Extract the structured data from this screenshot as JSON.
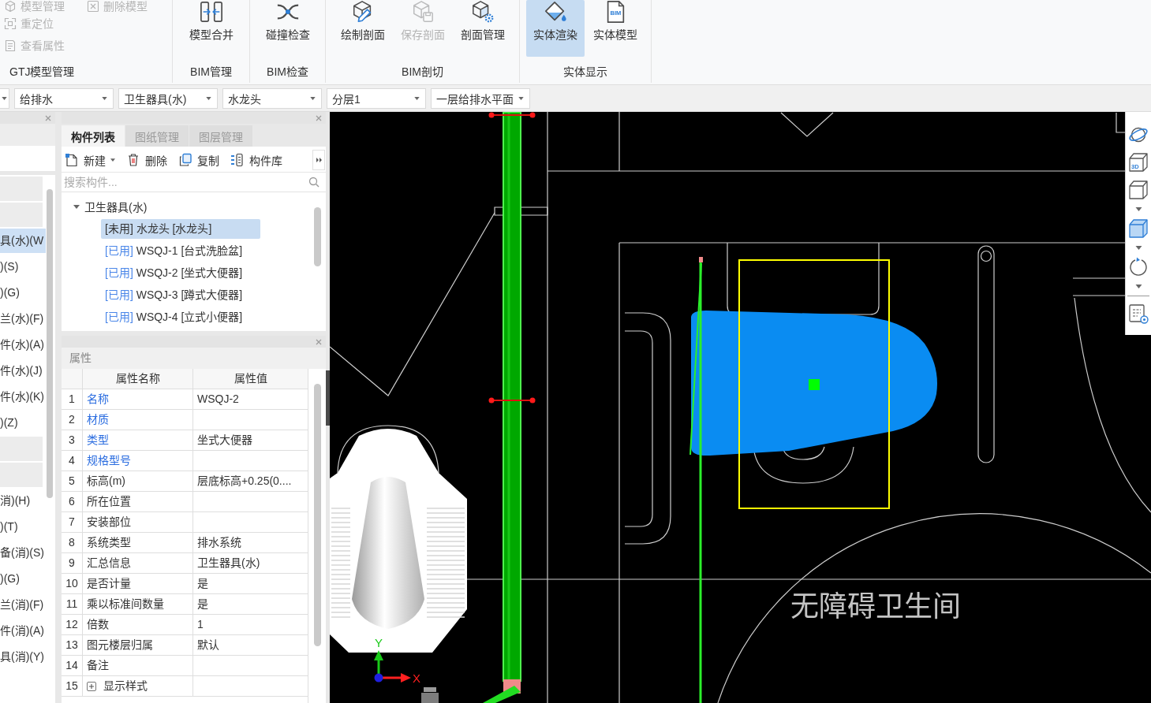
{
  "ribbon": {
    "groups": [
      {
        "label": "GTJ模型管理",
        "kind": "small",
        "buttons": [
          {
            "label": "模型管理",
            "disabled": true
          },
          {
            "label": "删除模型",
            "disabled": true
          },
          {
            "label": "重定位",
            "disabled": true
          },
          {
            "label": "查看属性",
            "disabled": true
          }
        ]
      },
      {
        "label": "BIM管理",
        "kind": "large",
        "buttons": [
          {
            "label": "模型合并",
            "disabled": false,
            "selected": false
          }
        ]
      },
      {
        "label": "BIM检查",
        "kind": "large",
        "buttons": [
          {
            "label": "碰撞检查",
            "disabled": false,
            "selected": false
          }
        ]
      },
      {
        "label": "BIM剖切",
        "kind": "large",
        "buttons": [
          {
            "label": "绘制剖面",
            "disabled": false,
            "selected": false
          },
          {
            "label": "保存剖面",
            "disabled": true,
            "selected": false
          },
          {
            "label": "剖面管理",
            "disabled": false,
            "selected": false
          }
        ]
      },
      {
        "label": "实体显示",
        "kind": "large",
        "buttons": [
          {
            "label": "实体渲染",
            "disabled": false,
            "selected": true
          },
          {
            "label": "实体模型",
            "disabled": false,
            "selected": false,
            "badge": "BIM"
          }
        ]
      }
    ]
  },
  "selectors": [
    {
      "kind": "clipped"
    },
    {
      "kind": "select",
      "value": "给排水"
    },
    {
      "kind": "select",
      "value": "卫生器具(水)"
    },
    {
      "kind": "select",
      "value": "水龙头"
    },
    {
      "kind": "select",
      "value": "分层1"
    },
    {
      "kind": "select",
      "value": "一层给排水平面"
    }
  ],
  "category_list": {
    "items": [
      {
        "kind": "header"
      },
      {
        "kind": "header"
      },
      {
        "kind": "item",
        "label": "具(水)(W",
        "selected": true
      },
      {
        "kind": "item",
        "label": ")(S)",
        "selected": false
      },
      {
        "kind": "item",
        "label": ")(G)",
        "selected": false
      },
      {
        "kind": "item",
        "label": "兰(水)(F)",
        "selected": false
      },
      {
        "kind": "item",
        "label": "件(水)(A)",
        "selected": false
      },
      {
        "kind": "item",
        "label": "件(水)(J)",
        "selected": false
      },
      {
        "kind": "item",
        "label": "件(水)(K)",
        "selected": false
      },
      {
        "kind": "item",
        "label": ")(Z)",
        "selected": false
      },
      {
        "kind": "header"
      },
      {
        "kind": "header"
      },
      {
        "kind": "item",
        "label": "消)(H)",
        "selected": false
      },
      {
        "kind": "item",
        "label": ")(T)",
        "selected": false
      },
      {
        "kind": "item",
        "label": "备(消)(S)",
        "selected": false
      },
      {
        "kind": "item",
        "label": ")(G)",
        "selected": false
      },
      {
        "kind": "item",
        "label": "兰(消)(F)",
        "selected": false
      },
      {
        "kind": "item",
        "label": "件(消)(A)",
        "selected": false
      },
      {
        "kind": "item",
        "label": "具(消)(Y)",
        "selected": false
      }
    ]
  },
  "component_panel": {
    "tabs": [
      {
        "label": "构件列表",
        "selected": true
      },
      {
        "label": "图纸管理",
        "selected": false
      },
      {
        "label": "图层管理",
        "selected": false
      }
    ],
    "toolbar": [
      {
        "label": "新建",
        "kind": "menu"
      },
      {
        "label": "删除",
        "kind": "button"
      },
      {
        "label": "复制",
        "kind": "button"
      },
      {
        "label": "构件库",
        "kind": "button"
      }
    ],
    "search": {
      "placeholder": "搜索构件..."
    },
    "tree": [
      {
        "label": "卫生器具(水)",
        "expanded": true,
        "children": [
          {
            "status": "[未用]",
            "label": "水龙头 [水龙头]",
            "used": false,
            "selected": true
          },
          {
            "status": "[已用]",
            "label": "WSQJ-1 [台式洗脸盆]",
            "used": true,
            "selected": false
          },
          {
            "status": "[已用]",
            "label": "WSQJ-2 [坐式大便器]",
            "used": true,
            "selected": false
          },
          {
            "status": "[已用]",
            "label": "WSQJ-3 [蹲式大便器]",
            "used": true,
            "selected": false
          },
          {
            "status": "[已用]",
            "label": "WSQJ-4 [立式小便器]",
            "used": true,
            "selected": false
          }
        ]
      }
    ]
  },
  "properties": {
    "title": "属性",
    "columns": [
      "属性名称",
      "属性值"
    ],
    "rows": [
      {
        "index": "1",
        "name": "名称",
        "value": "WSQJ-2",
        "public": true,
        "kind": "field"
      },
      {
        "index": "2",
        "name": "材质",
        "public": true,
        "kind": "field"
      },
      {
        "index": "3",
        "name": "类型",
        "value": "坐式大便器",
        "public": true,
        "kind": "field"
      },
      {
        "index": "4",
        "name": "规格型号",
        "public": true,
        "kind": "field"
      },
      {
        "index": "5",
        "name": "标高(m)",
        "value": "层底标高+0.25(0....",
        "public": false,
        "kind": "field"
      },
      {
        "index": "6",
        "name": "所在位置",
        "public": false,
        "kind": "field"
      },
      {
        "index": "7",
        "name": "安装部位",
        "public": false,
        "kind": "field"
      },
      {
        "index": "8",
        "name": "系统类型",
        "value": "排水系统",
        "public": false,
        "kind": "field"
      },
      {
        "index": "9",
        "name": "汇总信息",
        "value": "卫生器具(水)",
        "public": false,
        "kind": "field"
      },
      {
        "index": "10",
        "name": "是否计量",
        "value": "是",
        "public": false,
        "kind": "field"
      },
      {
        "index": "11",
        "name": "乘以标准间数量",
        "value": "是",
        "public": false,
        "kind": "field"
      },
      {
        "index": "12",
        "name": "倍数",
        "value": "1",
        "public": false,
        "kind": "field"
      },
      {
        "index": "13",
        "name": "图元楼层归属",
        "value": "默认",
        "public": false,
        "kind": "field"
      },
      {
        "index": "14",
        "name": "备注",
        "public": false,
        "kind": "field"
      },
      {
        "index": "15",
        "name": "显示样式",
        "public": false,
        "kind": "group"
      }
    ]
  },
  "canvas": {
    "room_label": "无障碍卫生间",
    "axis": {
      "x_label": "X",
      "y_label": "Y"
    },
    "view_toolbar": {
      "tools": [
        {
          "has_menu": false
        },
        {
          "has_menu": false,
          "badge": "3D"
        },
        {
          "has_menu": true
        },
        {
          "has_menu": true
        },
        {
          "has_menu": true
        },
        {
          "has_menu": false
        }
      ]
    }
  }
}
